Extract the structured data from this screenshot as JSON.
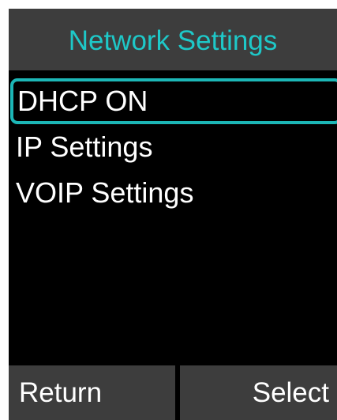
{
  "screen": {
    "title": "Network Settings"
  },
  "menu": {
    "items": [
      {
        "label": "DHCP ON",
        "selected": true
      },
      {
        "label": "IP Settings",
        "selected": false
      },
      {
        "label": "VOIP Settings",
        "selected": false
      }
    ]
  },
  "softkeys": {
    "left_label": "Return",
    "right_label": "Select"
  },
  "colors": {
    "accent": "#1ec8c8",
    "bar_background": "#3d3d3d",
    "screen_background": "#000000",
    "text": "#ffffff"
  }
}
